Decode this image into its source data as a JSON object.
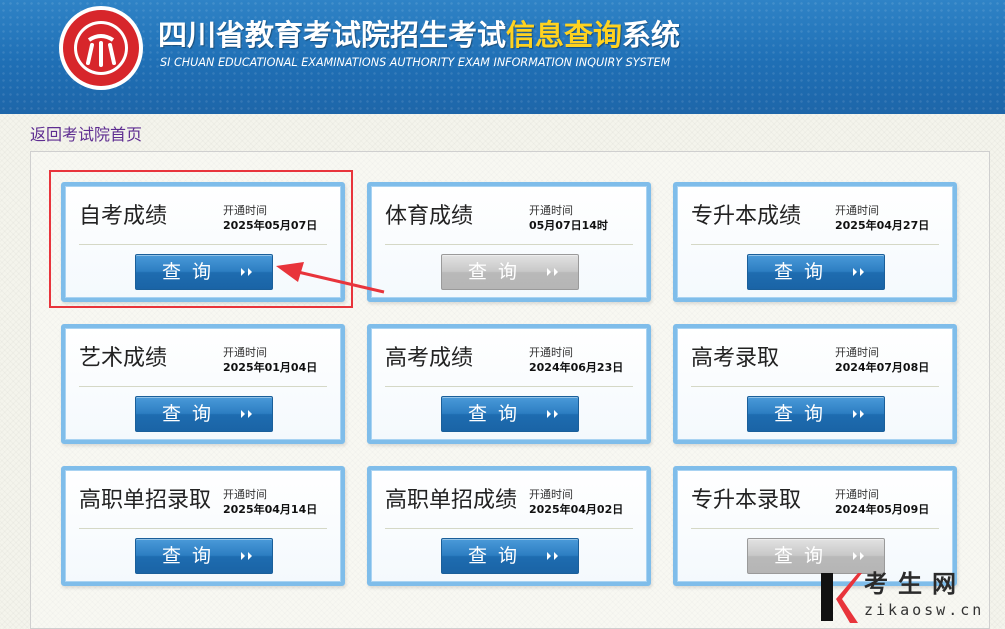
{
  "header": {
    "title_part1": "四川省教育考试院招生考试",
    "title_highlight": "信息查询",
    "title_part2": "系统",
    "subtitle": "SI CHUAN EDUCATIONAL EXAMINATIONS AUTHORITY EXAM INFORMATION INQUIRY SYSTEM",
    "logo_text": "四川省教育考试院",
    "colors": {
      "bar": "#1f6fb5",
      "highlight": "#ffd21f",
      "logo_red": "#d7262b"
    }
  },
  "back_link": "返回考试院首页",
  "open_label": "开通时间",
  "query_label": "查询",
  "cards": [
    {
      "title": "自考成绩",
      "open_time": "2025年05月07日",
      "enabled": true,
      "highlighted": true
    },
    {
      "title": "体育成绩",
      "open_time": "05月07日14时",
      "enabled": false
    },
    {
      "title": "专升本成绩",
      "open_time": "2025年04月27日",
      "enabled": true
    },
    {
      "title": "艺术成绩",
      "open_time": "2025年01月04日",
      "enabled": true
    },
    {
      "title": "高考成绩",
      "open_time": "2024年06月23日",
      "enabled": true
    },
    {
      "title": "高考录取",
      "open_time": "2024年07月08日",
      "enabled": true
    },
    {
      "title": "高职单招录取",
      "open_time": "2025年04月14日",
      "enabled": true
    },
    {
      "title": "高职单招成绩",
      "open_time": "2025年04月02日",
      "enabled": true
    },
    {
      "title": "专升本录取",
      "open_time": "2024年05月09日",
      "enabled": false
    }
  ],
  "watermark": {
    "cn": "考生网",
    "en": "zikaosw.cn",
    "logo_letter": "K"
  },
  "annotation_color": "#e8343b"
}
